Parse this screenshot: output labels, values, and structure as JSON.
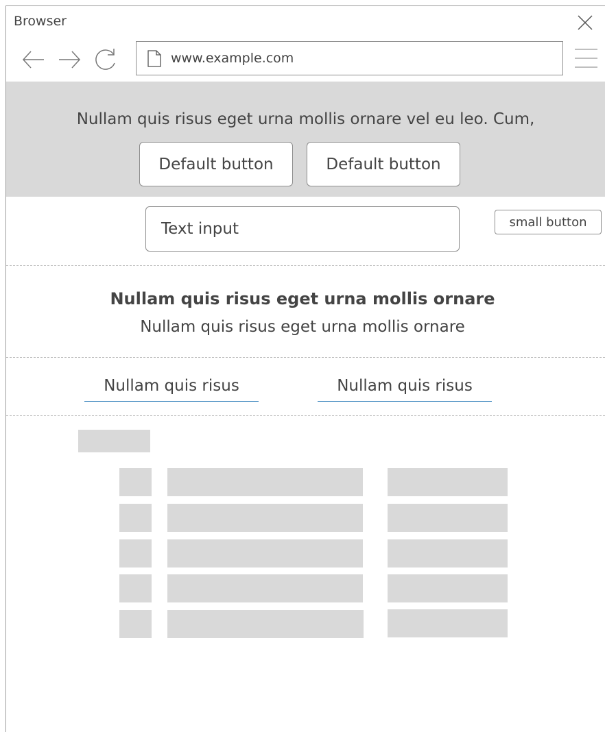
{
  "window": {
    "title": "Browser"
  },
  "address_bar": {
    "url": "www.example.com"
  },
  "icons": {
    "close": "close-icon",
    "back": "arrow-left-icon",
    "forward": "arrow-right-icon",
    "reload": "reload-icon",
    "page": "document-icon",
    "menu": "hamburger-menu-icon"
  },
  "hero": {
    "text": "Nullam quis risus eget urna mollis ornare vel eu leo. Cum,",
    "buttons": [
      "Default button",
      "Default button"
    ]
  },
  "form": {
    "input_value": "Text input",
    "small_button": "small button"
  },
  "content": {
    "heading": "Nullam quis risus eget urna mollis ornare",
    "subheading": "Nullam quis risus eget urna mollis ornare"
  },
  "links": [
    "Nullam quis risus",
    "Nullam quis risus"
  ],
  "colors": {
    "placeholder": "#d9d9d9",
    "link_underline": "#2a7bb8",
    "border": "#8c8c8c"
  }
}
